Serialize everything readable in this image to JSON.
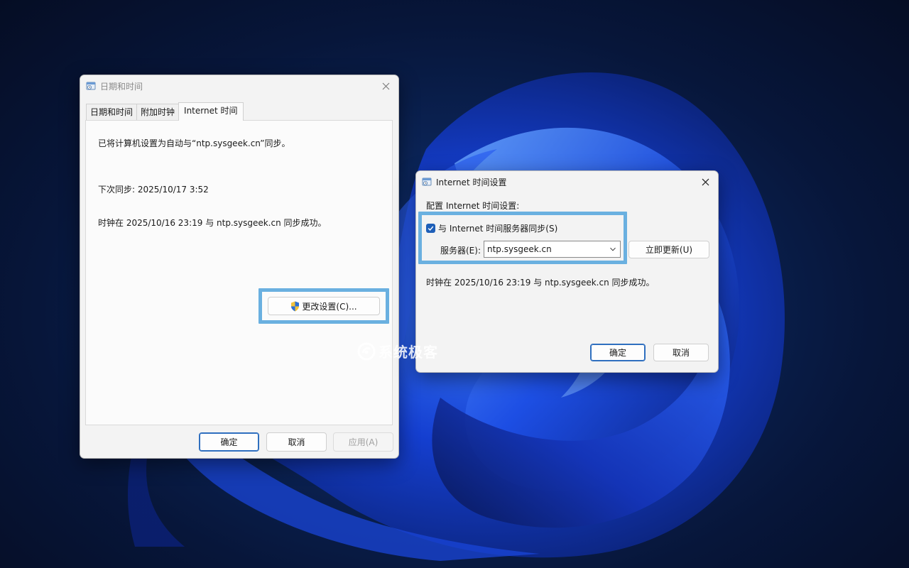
{
  "colors": {
    "accent": "#1f5fb8",
    "highlight": "#6ab0e0",
    "window_bg": "#f3f3f3"
  },
  "window_datetime": {
    "title": "日期和时间",
    "tabs": [
      {
        "label": "日期和时间"
      },
      {
        "label": "附加时钟"
      },
      {
        "label": "Internet 时间"
      }
    ],
    "active_tab_index": 2,
    "sync_message": "已将计算机设置为自动与“ntp.sysgeek.cn”同步。",
    "next_sync": "下次同步: 2025/10/17 3:52",
    "last_sync": "时钟在 2025/10/16 23:19 与 ntp.sysgeek.cn 同步成功。",
    "change_settings_label": "更改设置(C)...",
    "ok_label": "确定",
    "cancel_label": "取消",
    "apply_label": "应用(A)"
  },
  "window_internet_time": {
    "title": "Internet 时间设置",
    "section_label": "配置 Internet 时间设置:",
    "sync_checkbox_label": "与 Internet 时间服务器同步(S)",
    "sync_checked": true,
    "server_label": "服务器(E):",
    "server_value": "ntp.sysgeek.cn",
    "update_now_label": "立即更新(U)",
    "status": "时钟在 2025/10/16 23:19 与 ntp.sysgeek.cn 同步成功。",
    "ok_label": "确定",
    "cancel_label": "取消"
  },
  "watermark": {
    "text": "系统极客"
  }
}
